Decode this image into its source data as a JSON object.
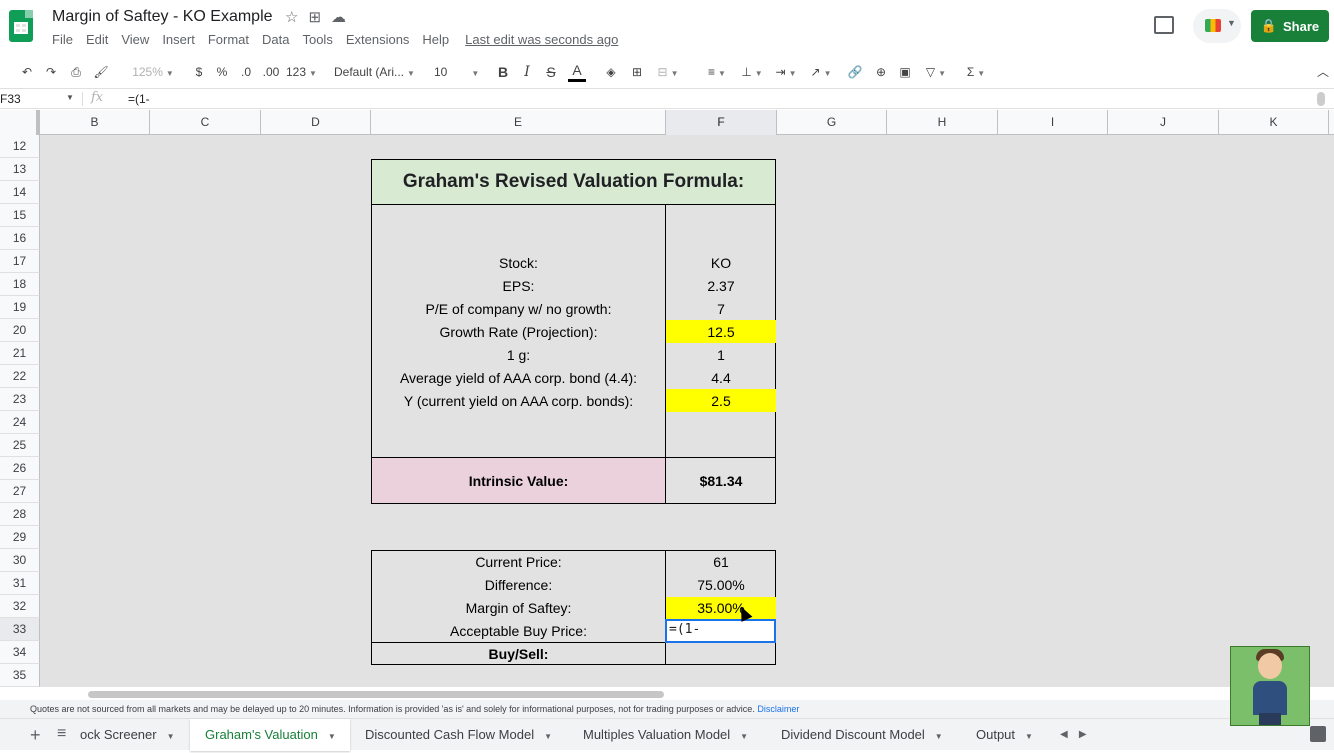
{
  "doc": {
    "title": "Margin of Saftey - KO Example",
    "menu": [
      "File",
      "Edit",
      "View",
      "Insert",
      "Format",
      "Data",
      "Tools",
      "Extensions",
      "Help"
    ],
    "last_edit": "Last edit was seconds ago",
    "share_label": "Share"
  },
  "toolbar": {
    "zoom": "125%",
    "currency": "$",
    "percent": "%",
    "dec_decrease": ".0",
    "dec_increase": ".00",
    "format_more": "123",
    "font": "Default (Ari...",
    "font_size": "10",
    "bold": "B",
    "italic": "I",
    "strike": "S",
    "text_color": "A"
  },
  "formula_bar": {
    "cell_ref": "F33",
    "fx": "fx",
    "formula": "=(1-"
  },
  "columns": [
    "B",
    "C",
    "D",
    "E",
    "F",
    "G",
    "H",
    "I",
    "J",
    "K"
  ],
  "rows": [
    "12",
    "13",
    "14",
    "15",
    "16",
    "17",
    "18",
    "19",
    "20",
    "21",
    "22",
    "23",
    "24",
    "25",
    "26",
    "27",
    "28",
    "29",
    "30",
    "31",
    "32",
    "33",
    "34",
    "35"
  ],
  "sheet": {
    "title": "Graham's Revised Valuation Formula:",
    "inputs": [
      {
        "label": "Stock:",
        "value": "KO"
      },
      {
        "label": "EPS:",
        "value": "2.37"
      },
      {
        "label": "P/E of company w/ no growth:",
        "value": "7"
      },
      {
        "label": "Growth Rate (Projection):",
        "value": "12.5"
      },
      {
        "label": "1 g:",
        "value": "1"
      },
      {
        "label": "Average yield of AAA corp. bond (4.4):",
        "value": "4.4"
      },
      {
        "label": "Y (current yield on AAA corp. bonds):",
        "value": "2.5"
      }
    ],
    "intrinsic_label": "Intrinsic Value:",
    "intrinsic_value": "$81.34",
    "mos": [
      {
        "label": "Current Price:",
        "value": "61"
      },
      {
        "label": "Difference:",
        "value": "75.00%"
      },
      {
        "label": "Margin of Saftey:",
        "value": "35.00%"
      },
      {
        "label": "Acceptable Buy Price:",
        "value": "=(1-"
      },
      {
        "label": "Buy/Sell:",
        "value": ""
      }
    ],
    "colors": {
      "title_bg": "#d9ead3",
      "highlight": "#ffff00",
      "intrinsic_bg": "#ead1dc",
      "selection": "#1a73e8"
    }
  },
  "disclaimer": {
    "text": "Quotes are not sourced from all markets and may be delayed up to 20 minutes. Information is provided 'as is' and solely for informational purposes, not for trading purposes or advice.",
    "link": "Disclaimer"
  },
  "tabs": [
    {
      "label": "ock Screener"
    },
    {
      "label": "Graham's Valuation",
      "active": true
    },
    {
      "label": "Discounted Cash Flow Model"
    },
    {
      "label": "Multiples Valuation Model"
    },
    {
      "label": "Dividend Discount Model"
    },
    {
      "label": "Output"
    }
  ]
}
